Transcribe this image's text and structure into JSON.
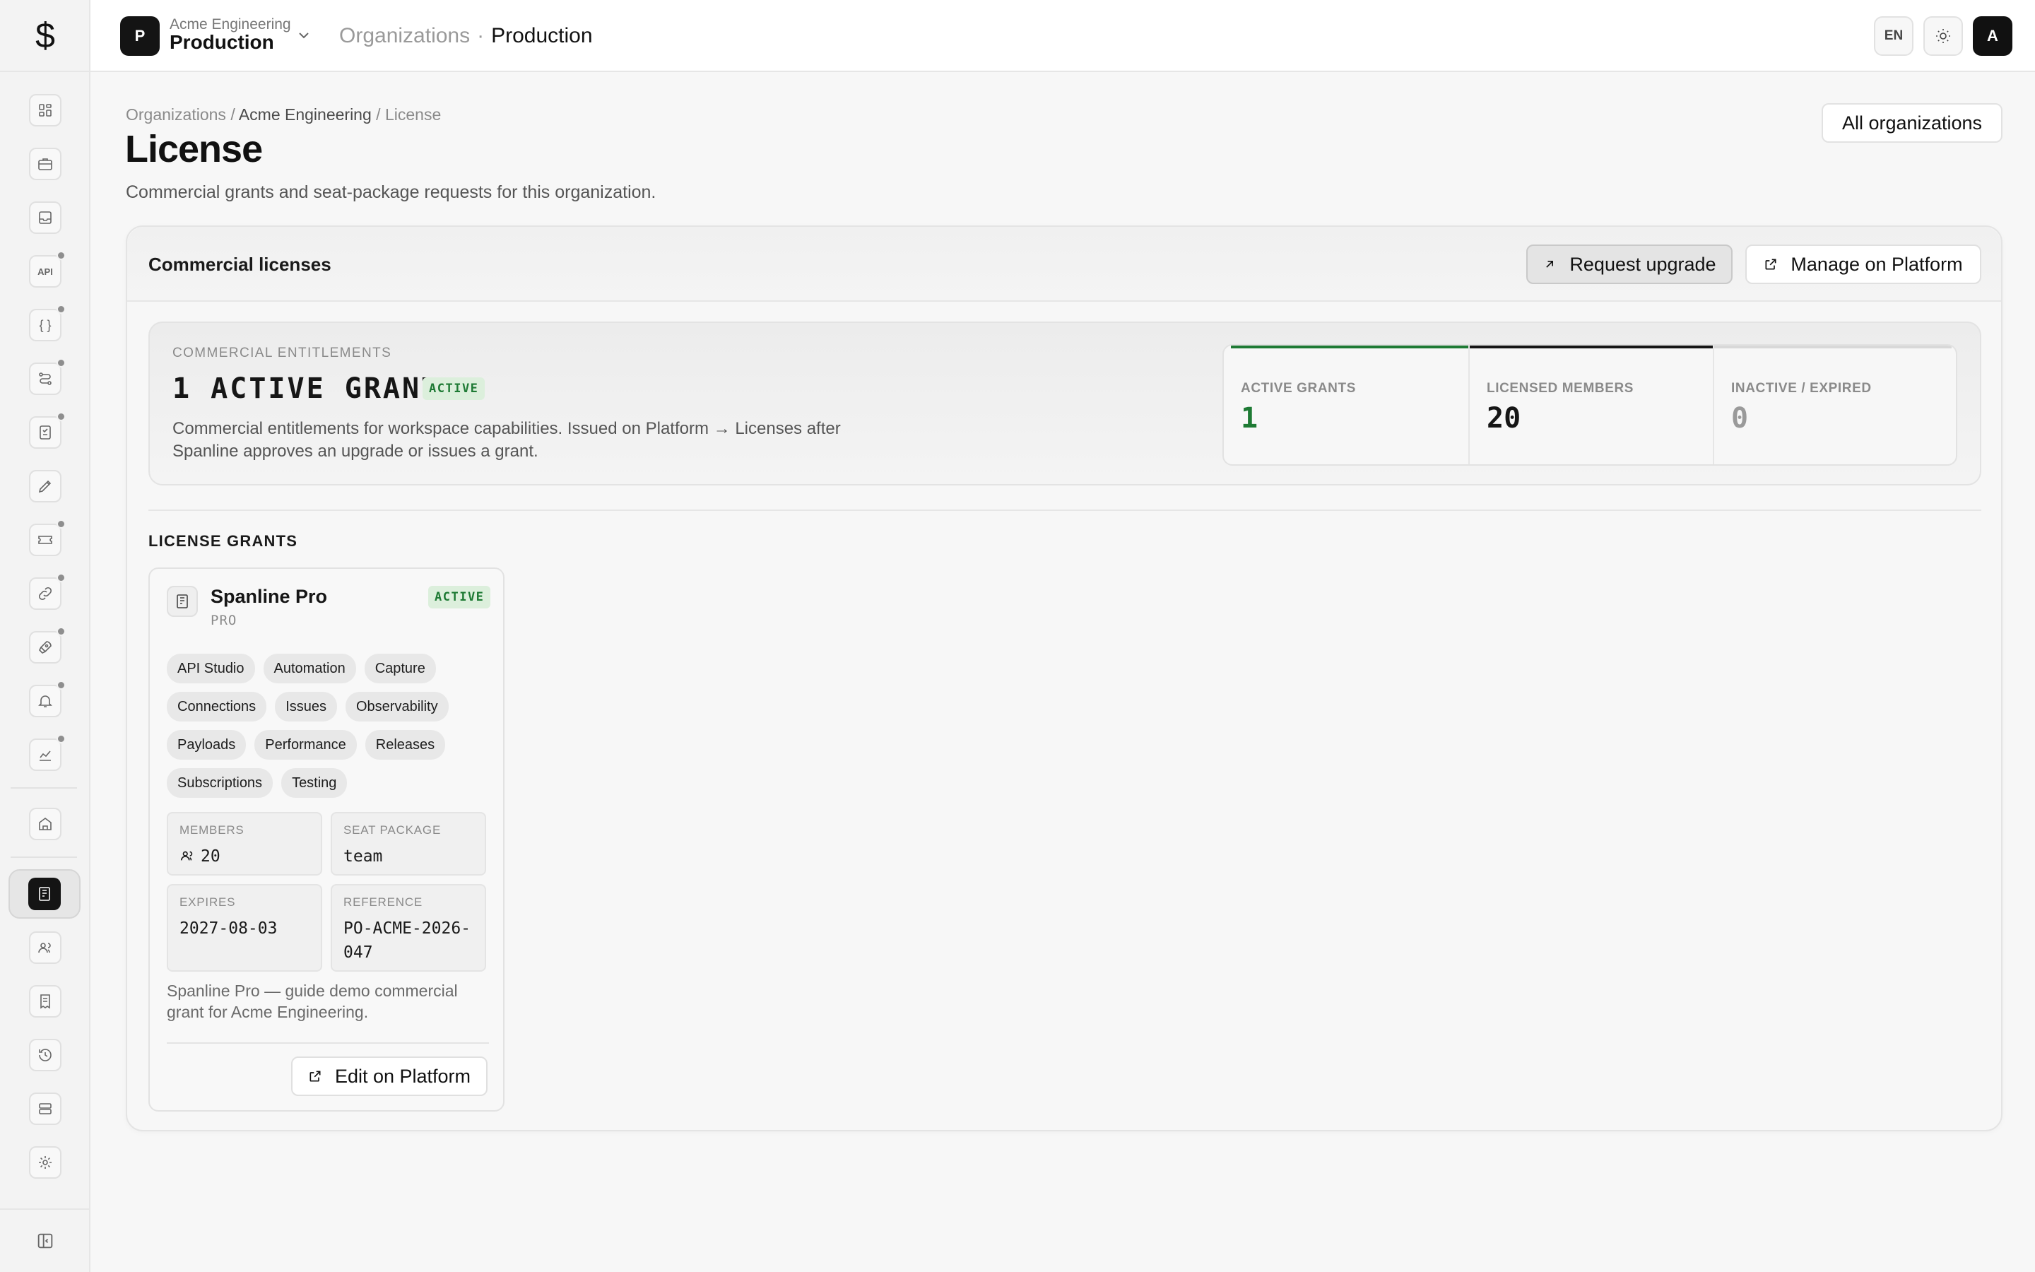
{
  "topbar": {
    "workspace_initial": "P",
    "workspace_org": "Acme Engineering",
    "workspace_name": "Production",
    "crumb_parent": "Organizations",
    "crumb_sep": "·",
    "crumb_current": "Production",
    "lang": "EN",
    "avatar_initial": "A"
  },
  "sidebar": {
    "logo": "$",
    "api_label": "API",
    "code_label": "{ }",
    "items": [
      {
        "icon": "dashboard-icon"
      },
      {
        "icon": "briefcase-icon"
      },
      {
        "icon": "inbox-icon"
      },
      {
        "icon": "api-icon",
        "badge": true
      },
      {
        "icon": "code-braces-icon",
        "badge": true
      },
      {
        "icon": "route-icon",
        "badge": true
      },
      {
        "icon": "checklist-icon",
        "badge": true
      },
      {
        "icon": "pen-icon"
      },
      {
        "icon": "ticket-icon",
        "badge": true
      },
      {
        "icon": "link-icon",
        "badge": true
      },
      {
        "icon": "rocket-icon",
        "badge": true
      },
      {
        "icon": "bell-icon",
        "badge": true
      },
      {
        "icon": "chart-icon",
        "badge": true
      },
      {
        "icon": "building-icon"
      },
      {
        "icon": "license-icon",
        "active": true
      },
      {
        "icon": "users-icon"
      },
      {
        "icon": "receipt-icon"
      },
      {
        "icon": "history-icon"
      },
      {
        "icon": "storage-icon"
      },
      {
        "icon": "gear-icon"
      }
    ]
  },
  "header": {
    "breadcrumb": {
      "root": "Organizations",
      "sep": "/",
      "org": "Acme Engineering",
      "current": "License"
    },
    "title": "License",
    "subtitle": "Commercial grants and seat-package requests for this organization.",
    "all_orgs_button": "All organizations"
  },
  "card": {
    "title": "Commercial licenses",
    "request_upgrade_label": "Request upgrade",
    "manage_label": "Manage on Platform",
    "entitlements": {
      "eyebrow": "COMMERCIAL ENTITLEMENTS",
      "headline": "1 ACTIVE GRANT",
      "status": "ACTIVE",
      "description": "Commercial entitlements for workspace capabilities. Issued on Platform → Licenses after Spanline approves an upgrade or issues a grant."
    },
    "stats": [
      {
        "label": "ACTIVE GRANTS",
        "value": "1",
        "color": "#1e7a34",
        "bar": "#1e7a34"
      },
      {
        "label": "LICENSED MEMBERS",
        "value": "20",
        "color": "#161616",
        "bar": "#161616"
      },
      {
        "label": "INACTIVE / EXPIRED",
        "value": "0",
        "color": "#9a9a9a",
        "bar": "#d8d8d8"
      }
    ],
    "grants_title": "LICENSE GRANTS",
    "grant": {
      "name": "Spanline Pro",
      "tier": "PRO",
      "status": "ACTIVE",
      "features": [
        "API Studio",
        "Automation",
        "Capture",
        "Connections",
        "Issues",
        "Observability",
        "Payloads",
        "Performance",
        "Releases",
        "Subscriptions",
        "Testing"
      ],
      "members_label": "MEMBERS",
      "members_value": "20",
      "seat_label": "SEAT PACKAGE",
      "seat_value": "team",
      "expires_label": "EXPIRES",
      "expires_value": "2027-08-03",
      "reference_label": "REFERENCE",
      "reference_value": "PO-ACME-2026-047",
      "note": "Spanline Pro — guide demo commercial grant for Acme Engineering.",
      "edit_label": "Edit on Platform"
    }
  }
}
